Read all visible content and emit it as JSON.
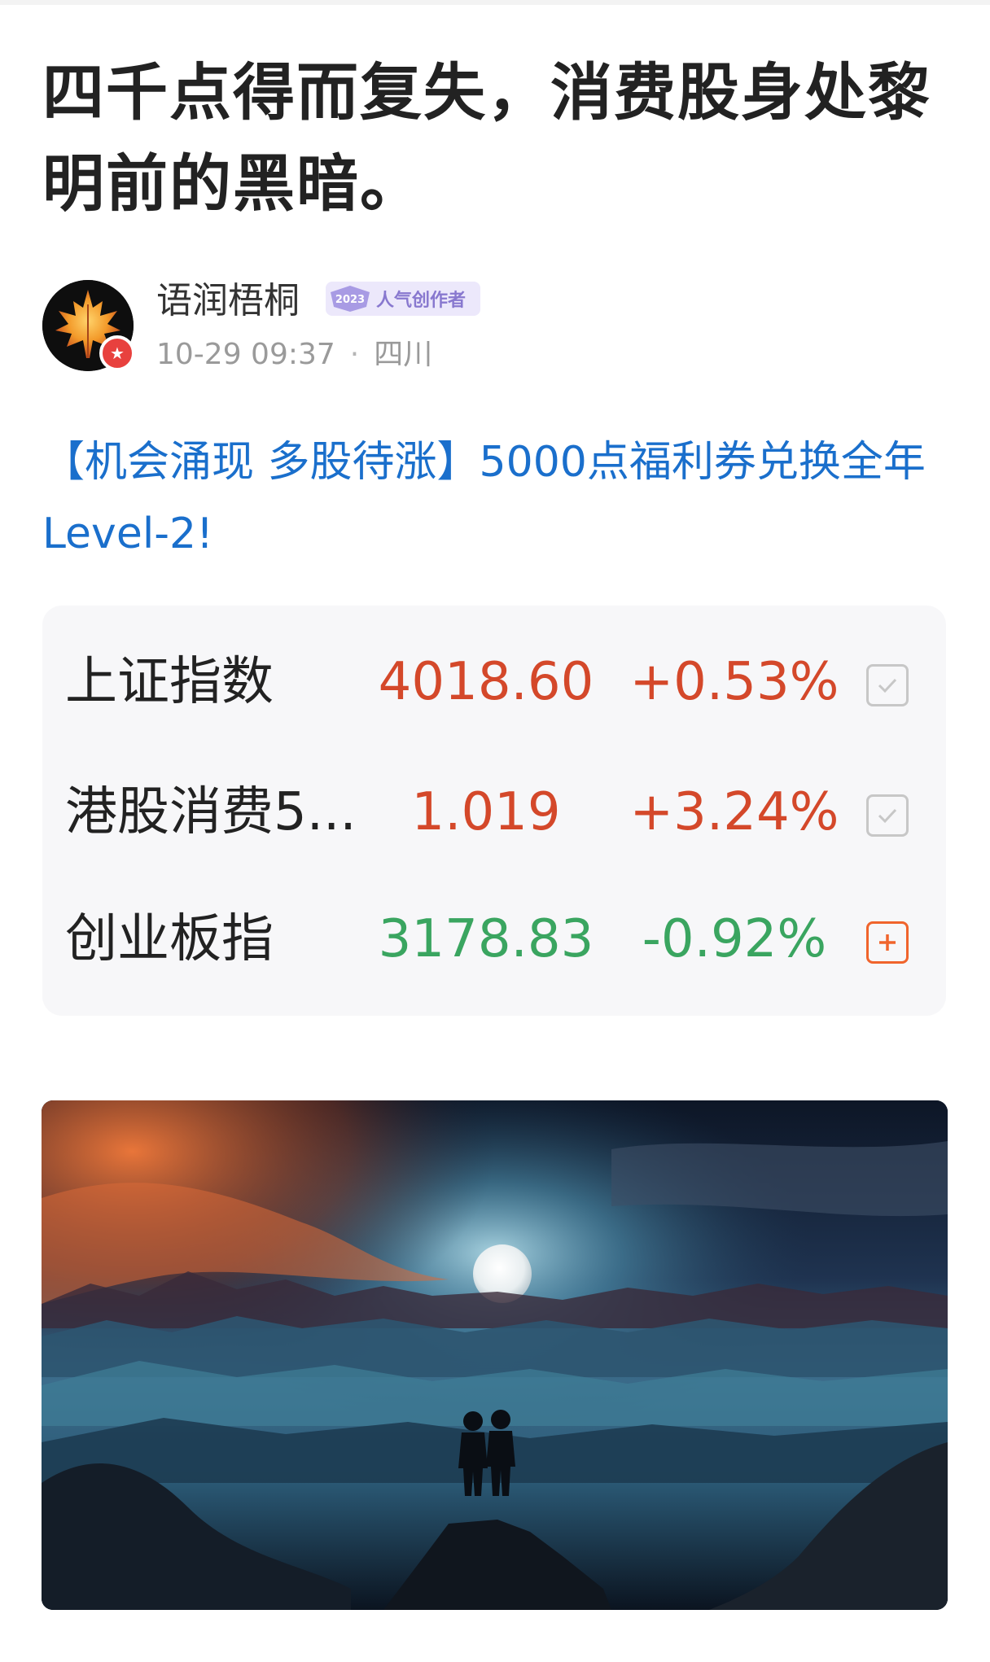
{
  "article": {
    "title": "四千点得而复失，消费股身处黎明前的黑暗。",
    "promo_link": "【机会涌现 多股待涨】5000点福利券兑换全年Level-2!"
  },
  "author": {
    "name": "语润梧桐",
    "badge_year": "2023",
    "badge_label": "人气创作者",
    "time": "10-29 09:37",
    "separator": "·",
    "location": "四川"
  },
  "quotes": [
    {
      "name": "上证指数",
      "price": "4018.60",
      "change": "+0.53%",
      "direction": "up",
      "status": "checked"
    },
    {
      "name": "港股消费5...",
      "price": "1.019",
      "change": "+3.24%",
      "direction": "up",
      "status": "checked"
    },
    {
      "name": "创业板指",
      "price": "3178.83",
      "change": "-0.92%",
      "direction": "down",
      "status": "add"
    }
  ],
  "colors": {
    "up": "#d4482a",
    "down": "#3aa560",
    "link": "#1a6fcc",
    "add_icon": "#f0642c"
  },
  "icons": {
    "avatar": "maple-leaf",
    "avatar_badge": "star-icon",
    "watch_checked": "checkbox-checked-icon",
    "watch_add": "plus-box-icon"
  }
}
